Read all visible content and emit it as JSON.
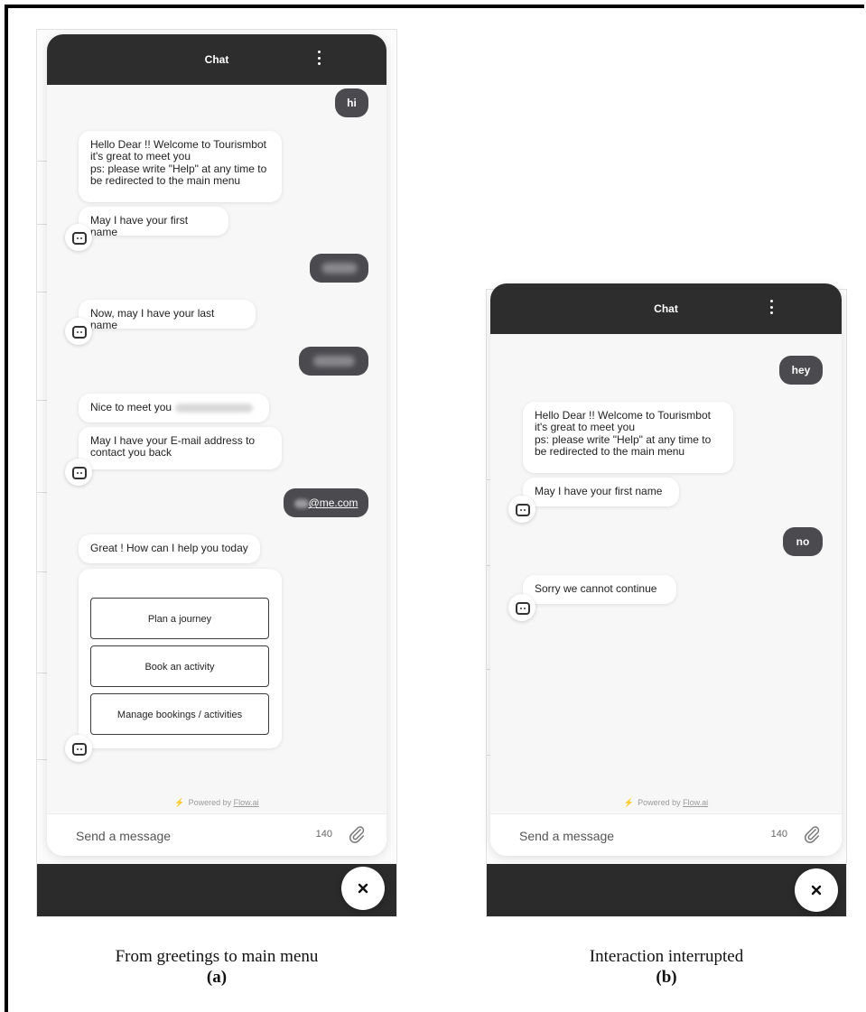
{
  "panel_a": {
    "header_title": "Chat",
    "messages": {
      "user_hi": "hi",
      "welcome_lines": [
        "Hello Dear !! Welcome to Tourismbot",
        "it's great to meet you",
        "ps: please write \"Help\" at any time to",
        "be redirected to the main menu"
      ],
      "ask_first_name": "May I have your first name",
      "ask_last_name": "Now, may I have your last name",
      "nice_to_meet": "Nice to meet you",
      "ask_email_lines": [
        "May I have your E-mail address to",
        "contact you back"
      ],
      "user_email": "@me.com",
      "help_today": "Great ! How can I help you today"
    },
    "options": [
      "Plan a journey",
      "Book an activity",
      "Manage bookings / activities"
    ],
    "powered_by": "Powered by",
    "powered_link": "Flow.ai",
    "input_placeholder": "Send a message",
    "char_count": "140",
    "caption": "From greetings to main menu",
    "caption_label": "(a)"
  },
  "panel_b": {
    "header_title": "Chat",
    "messages": {
      "user_hey": "hey",
      "welcome_lines": [
        "Hello Dear !! Welcome to Tourismbot",
        "it's great to meet you",
        "ps: please write \"Help\" at any time to",
        "be redirected to the main menu"
      ],
      "ask_first_name": "May I have your first name",
      "user_no": "no",
      "sorry": "Sorry we cannot continue"
    },
    "powered_by": "Powered by",
    "powered_link": "Flow.ai",
    "input_placeholder": "Send a message",
    "char_count": "140",
    "caption": "Interaction interrupted",
    "caption_label": "(b)"
  },
  "icons": [
    "kebab-menu-icon",
    "bot-avatar-icon",
    "bolt-icon",
    "paperclip-icon",
    "close-icon"
  ],
  "colors": {
    "header_bg": "#2d2d2d",
    "user_bubble": "#4a4a4f",
    "widget_bg": "#f7f7f7",
    "bolt": "#f2b800"
  }
}
